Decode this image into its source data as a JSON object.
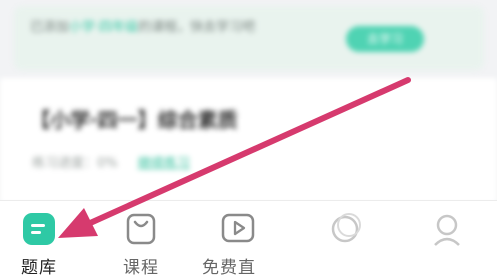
{
  "banner": {
    "text_prefix": "已添加",
    "text_highlight": "小学·四年级",
    "text_suffix": "的课程，快去学习吧",
    "button_label": "去学习"
  },
  "course": {
    "title": "【小学·四一】综合素质",
    "progress_label": "练习进度：0%",
    "continue_label": "继续练习"
  },
  "tabbar": {
    "items": [
      {
        "label": "题库",
        "icon": "question-bank-icon",
        "active": true
      },
      {
        "label": "课程",
        "icon": "shopping-bag-icon",
        "active": false
      },
      {
        "label": "免费直",
        "icon": "live-play-icon",
        "active": false
      },
      {
        "label": "",
        "icon": "tab4-icon",
        "active": false
      },
      {
        "label": "",
        "icon": "tab5-icon",
        "active": false
      }
    ]
  },
  "colors": {
    "accent": "#36c7a6",
    "arrow": "#d63a6e"
  }
}
